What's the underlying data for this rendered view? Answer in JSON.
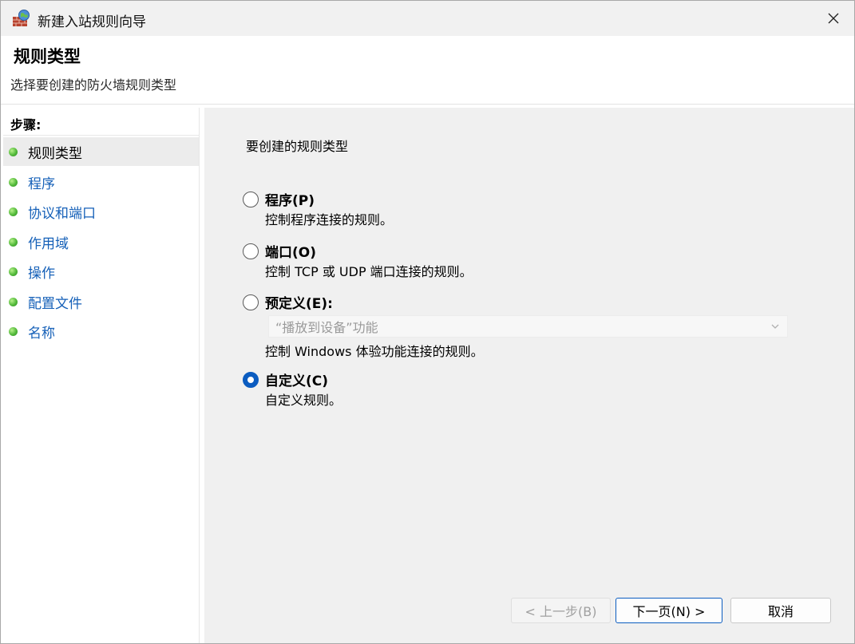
{
  "window": {
    "title": "新建入站规则向导",
    "close_icon": "×"
  },
  "header": {
    "title": "规则类型",
    "subtitle": "选择要创建的防火墙规则类型"
  },
  "steps": {
    "title": "步骤:",
    "items": [
      {
        "label": "规则类型",
        "active": true
      },
      {
        "label": "程序",
        "active": false
      },
      {
        "label": "协议和端口",
        "active": false
      },
      {
        "label": "作用域",
        "active": false
      },
      {
        "label": "操作",
        "active": false
      },
      {
        "label": "配置文件",
        "active": false
      },
      {
        "label": "名称",
        "active": false
      }
    ]
  },
  "content": {
    "prompt": "要创建的规则类型",
    "options": [
      {
        "label": "程序(P)",
        "desc": "控制程序连接的规则。",
        "checked": false
      },
      {
        "label": "端口(O)",
        "desc": "控制 TCP 或 UDP 端口连接的规则。",
        "checked": false
      },
      {
        "label": "预定义(E):",
        "desc": "控制 Windows 体验功能连接的规则。",
        "checked": false
      },
      {
        "label": "自定义(C)",
        "desc": "自定义规则。",
        "checked": true
      }
    ],
    "predefined_select": {
      "value": "“播放到设备”功能"
    }
  },
  "buttons": {
    "back": "< 上一步(B)",
    "next": "下一页(N) >",
    "cancel": "取消"
  },
  "colors": {
    "accent": "#0b5cc0",
    "link": "#1560b8",
    "step_dot": "#52b93a"
  }
}
